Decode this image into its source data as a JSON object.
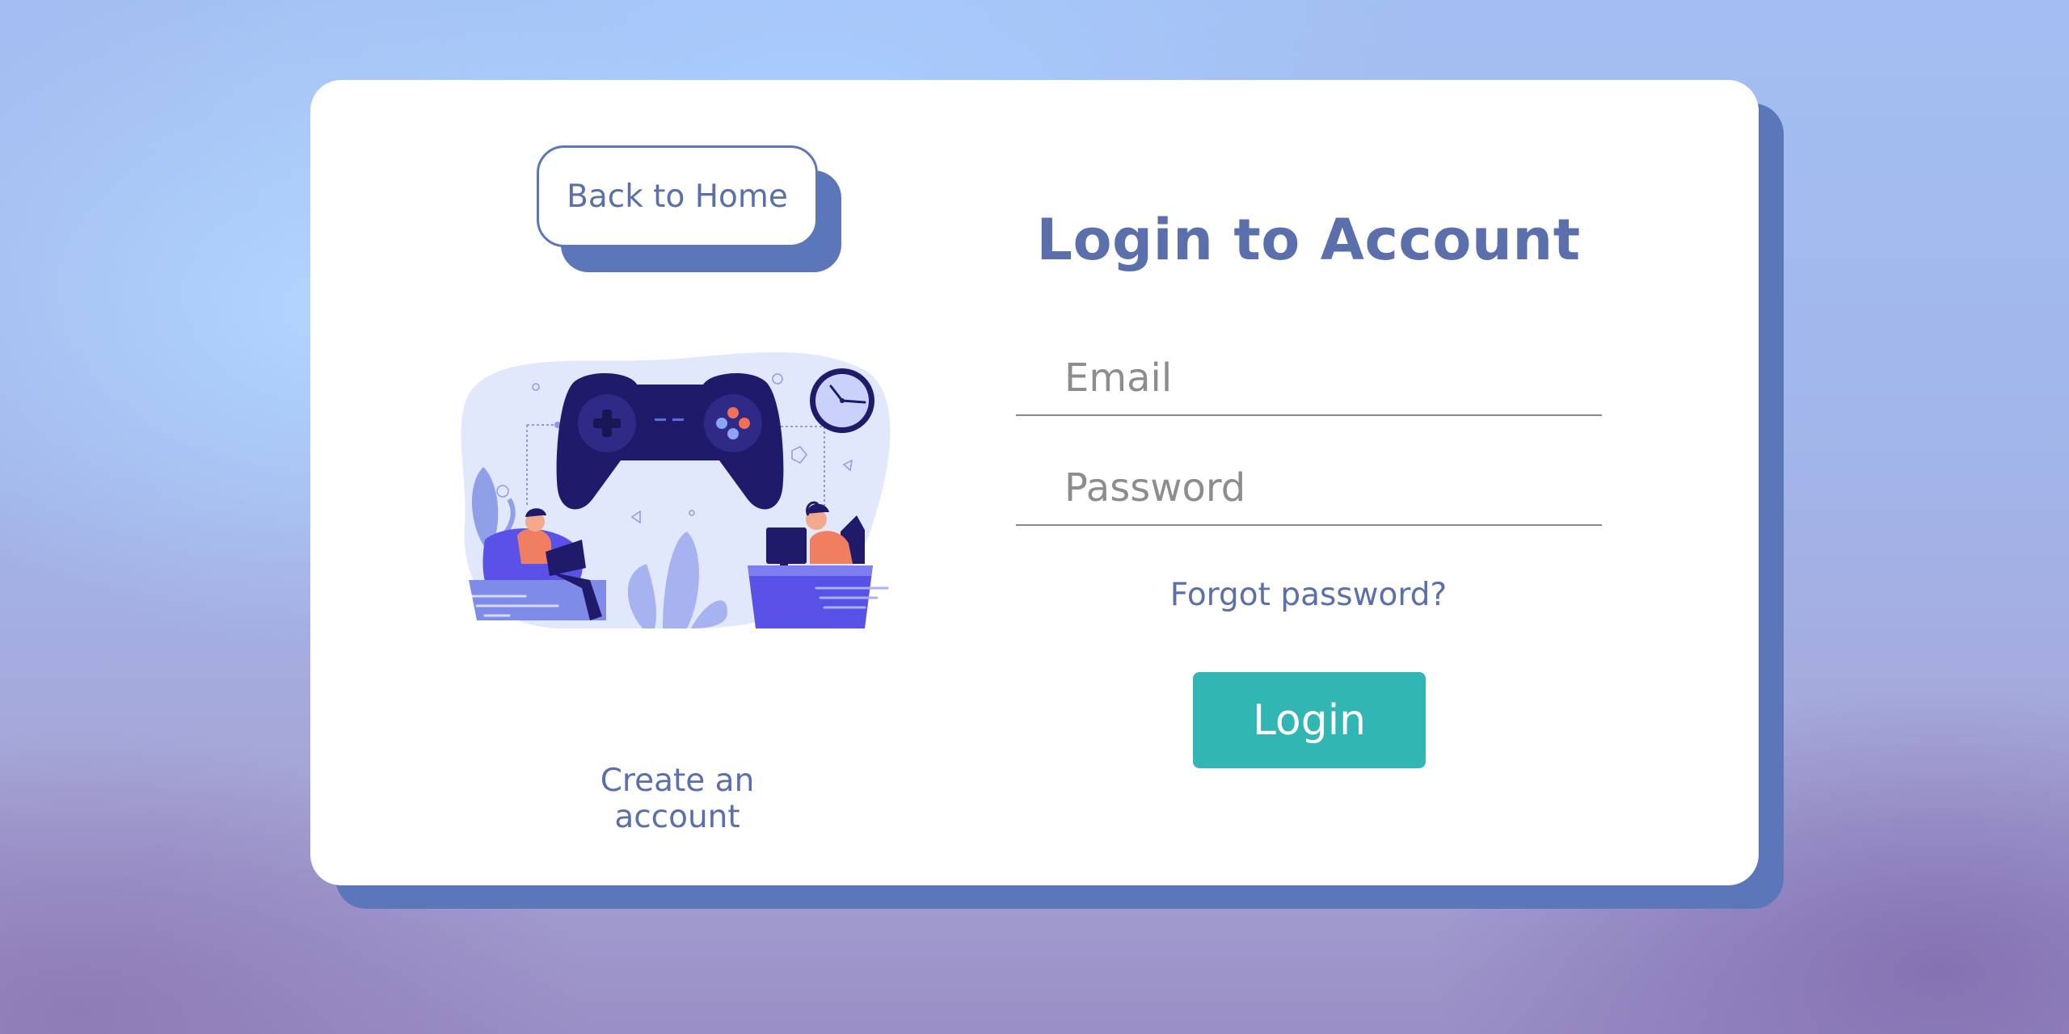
{
  "nav": {
    "back_label": "Back to Home"
  },
  "login": {
    "title": "Login to Account",
    "email_placeholder": "Email",
    "password_placeholder": "Password",
    "forgot_label": "Forgot password?",
    "submit_label": "Login"
  },
  "signup": {
    "create_label": "Create an account"
  },
  "illustration": {
    "icon": "gaming-illustration"
  },
  "colors": {
    "accent": "#5b77ba",
    "text": "#5b6fad",
    "button": "#31b6b4",
    "card": "#ffffff"
  }
}
